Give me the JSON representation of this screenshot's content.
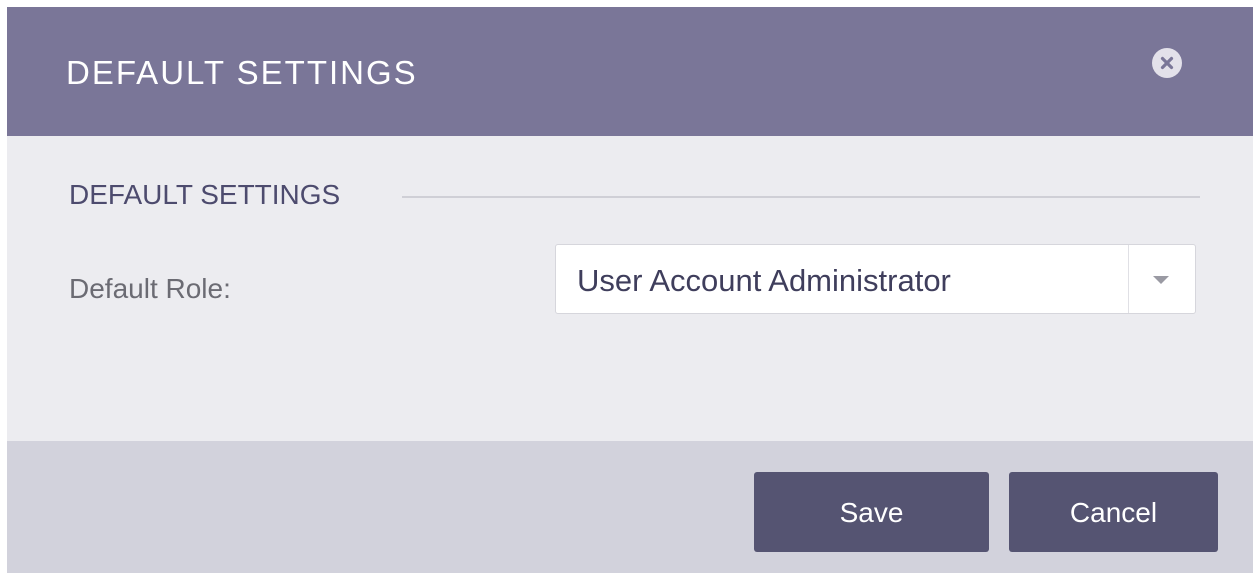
{
  "dialog": {
    "title": "DEFAULT SETTINGS",
    "close_icon": "close-icon"
  },
  "section": {
    "title": "DEFAULT SETTINGS"
  },
  "form": {
    "default_role_label": "Default Role:",
    "default_role_value": "User Account Administrator"
  },
  "footer": {
    "save_label": "Save",
    "cancel_label": "Cancel"
  },
  "colors": {
    "header_bg": "#7a7698",
    "body_bg": "#ececf0",
    "footer_bg": "#d2d2dc",
    "button_bg": "#555472",
    "section_title": "#4d4b6e"
  }
}
